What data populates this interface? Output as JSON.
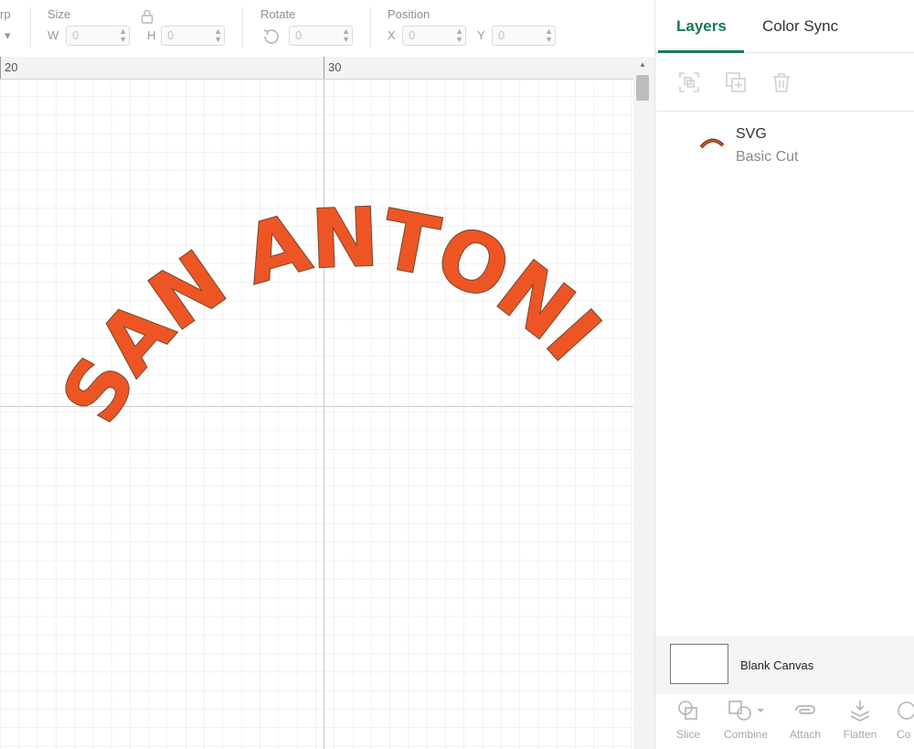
{
  "toolbar": {
    "warp_label": "rp",
    "warp_caret": "▾",
    "size_label": "Size",
    "width_axis": "W",
    "width_value": "0",
    "height_axis": "H",
    "height_value": "0",
    "rotate_label": "Rotate",
    "rotate_value": "0",
    "position_label": "Position",
    "x_axis": "X",
    "x_value": "0",
    "y_axis": "Y",
    "y_value": "0"
  },
  "ruler": {
    "marks": [
      "20",
      "30"
    ]
  },
  "artwork": {
    "text": "SAN ANTONIO",
    "fill": "#ee5524",
    "stroke": "#6e4a2e"
  },
  "panel": {
    "tabs": [
      "Layers",
      "Color Sync"
    ],
    "accent": "#167b4f",
    "layer": {
      "title": "SVG",
      "subtitle": "Basic Cut",
      "thumb_text": "SAN ANTONIO"
    },
    "blank_canvas": "Blank Canvas",
    "actions": [
      "Slice",
      "Combine",
      "Attach",
      "Flatten",
      "Co"
    ]
  }
}
